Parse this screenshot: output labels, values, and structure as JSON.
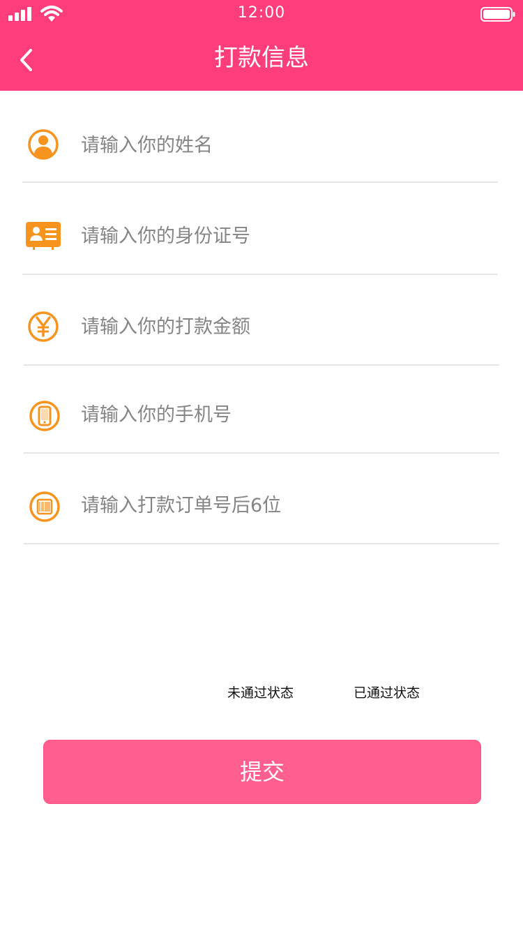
{
  "status_bar": {
    "time": "12:00"
  },
  "nav": {
    "title": "打款信息"
  },
  "fields": [
    {
      "icon": "user-icon",
      "placeholder": "请输入你的姓名"
    },
    {
      "icon": "id-card-icon",
      "placeholder": "请输入你的身份证号"
    },
    {
      "icon": "yen-icon",
      "placeholder": "请输入你的打款金额"
    },
    {
      "icon": "phone-icon",
      "placeholder": "请输入你的手机号"
    },
    {
      "icon": "barcode-icon",
      "placeholder": "请输入打款订单号后6位"
    }
  ],
  "status_links": {
    "not_passed": "未通过状态",
    "passed": "已通过状态"
  },
  "submit_label": "提交",
  "colors": {
    "header": "#ff3d7a",
    "accent_icon": "#f7941d",
    "button": "#ff5f8f"
  }
}
